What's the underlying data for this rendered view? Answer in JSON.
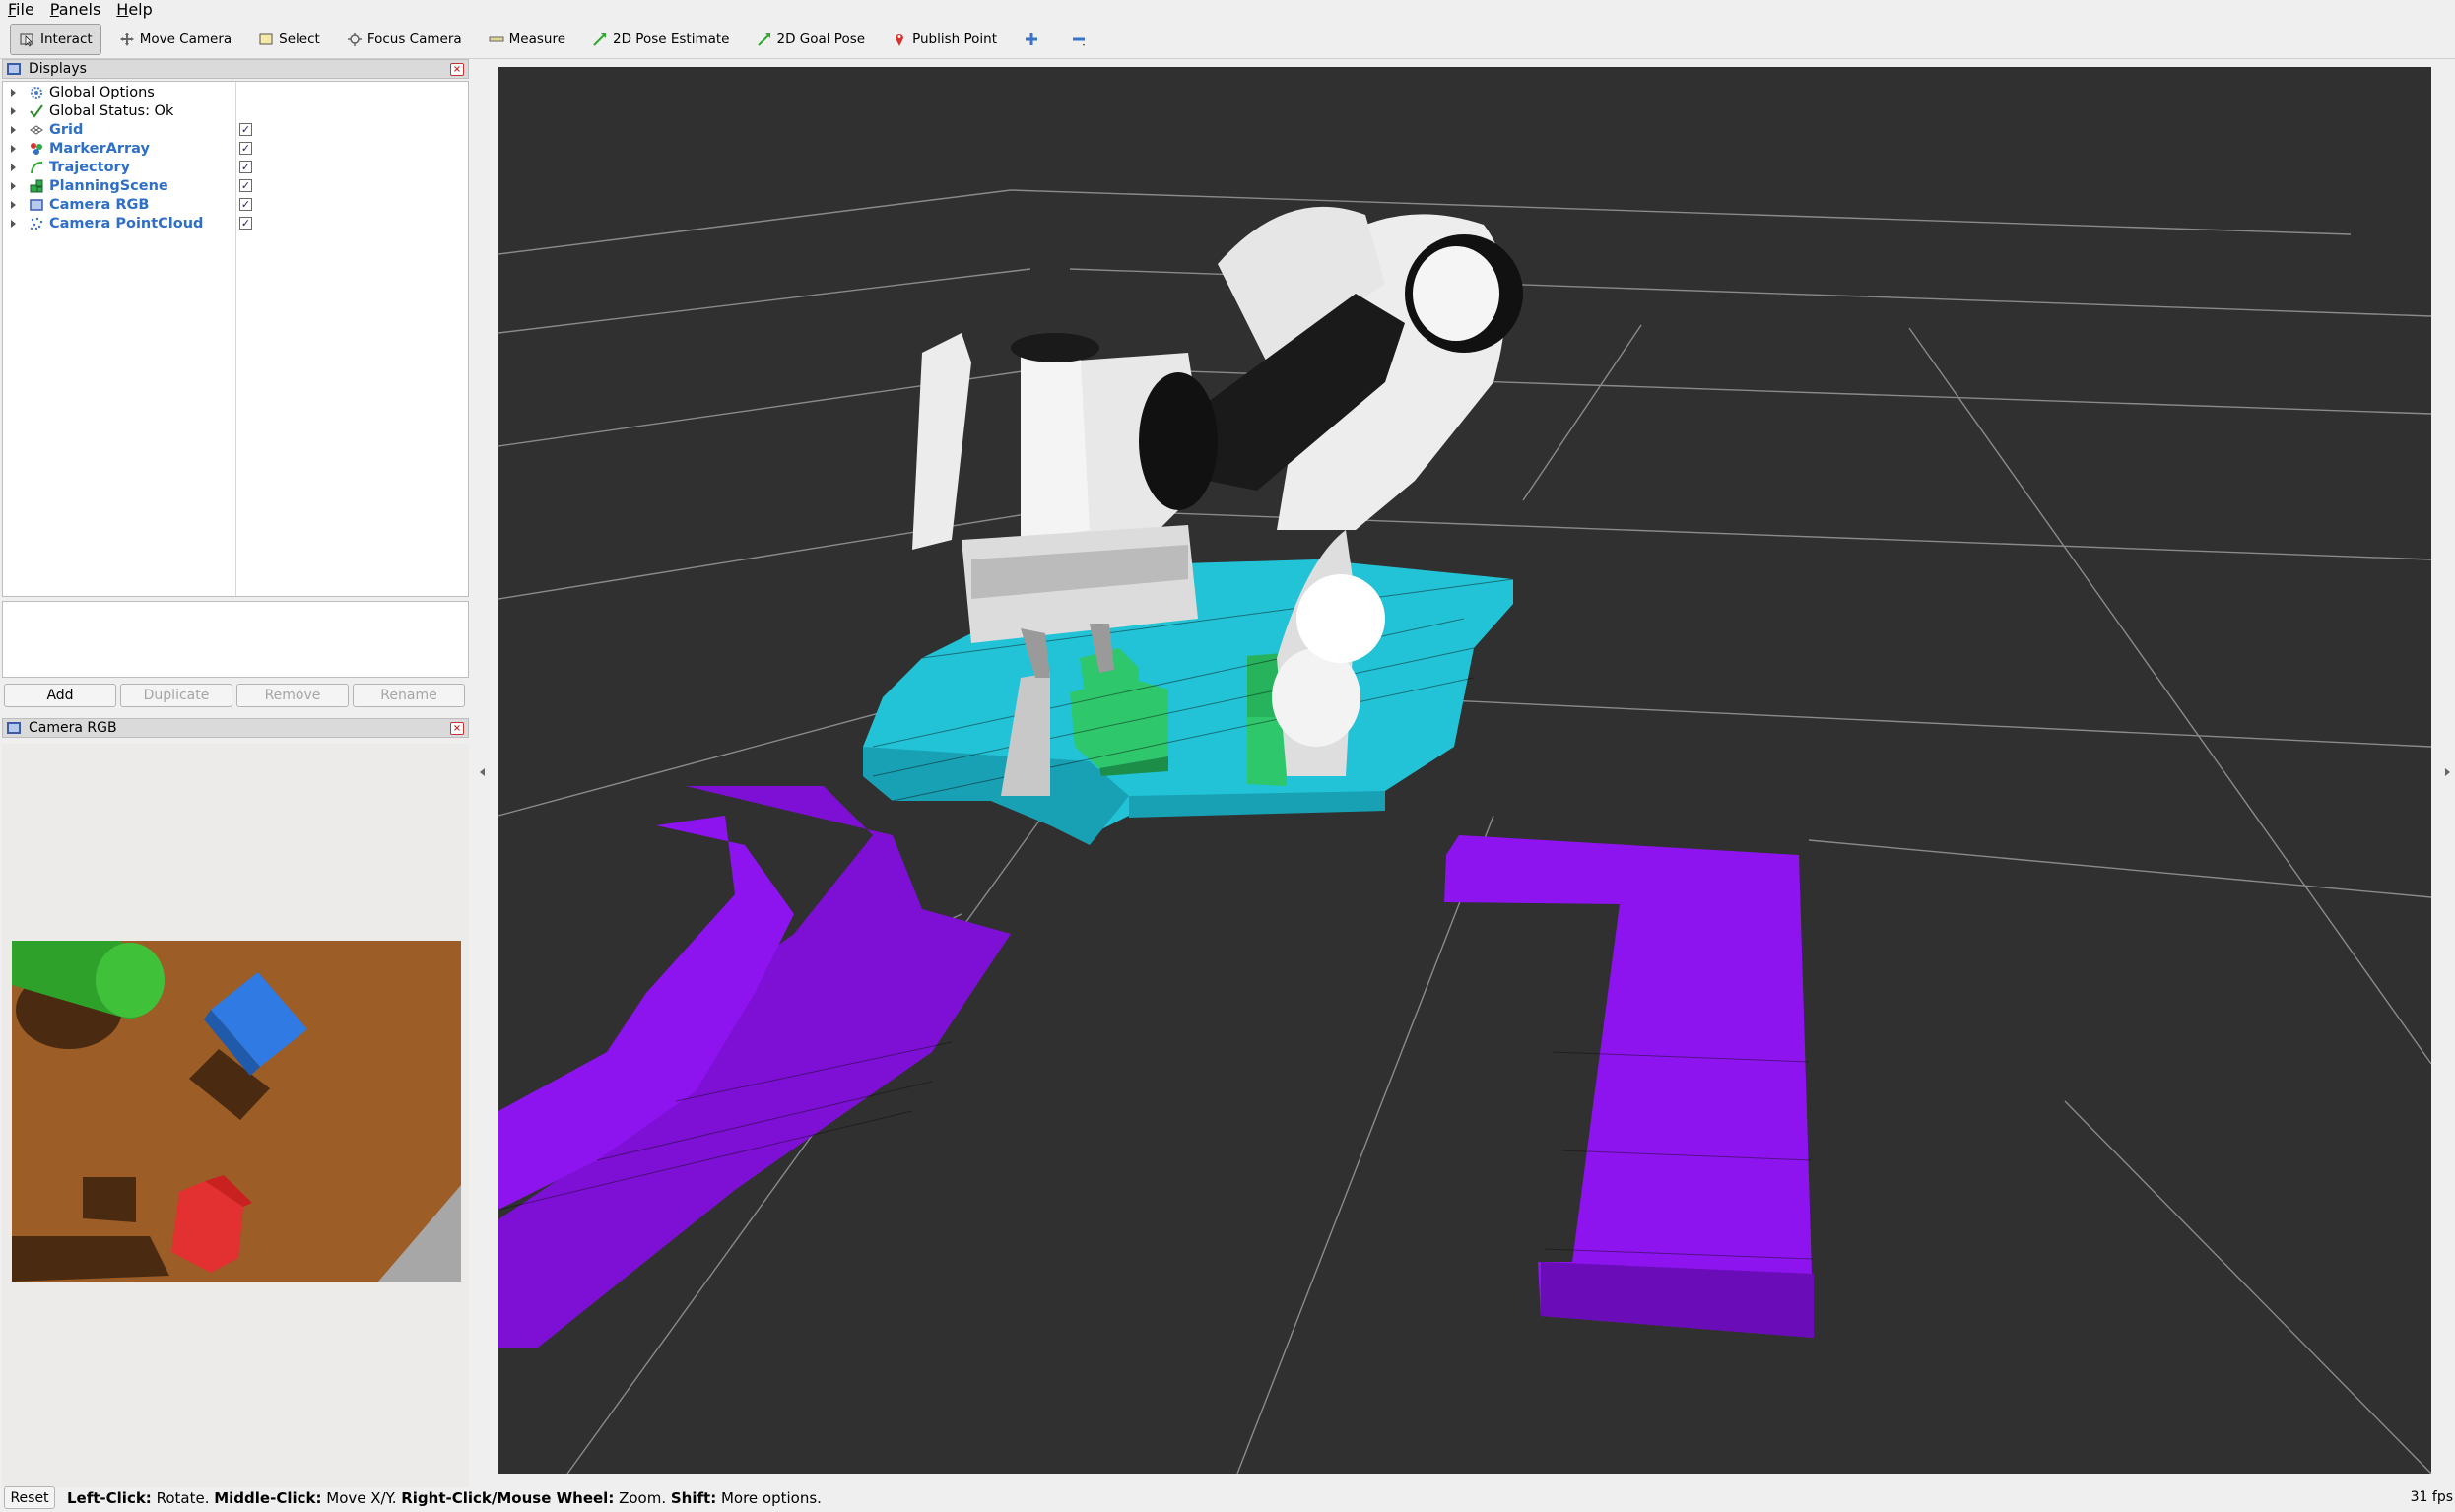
{
  "menu": [
    "File",
    "Panels",
    "Help"
  ],
  "toolbar": {
    "tools": [
      {
        "label": "Interact",
        "icon": "cursor-icon",
        "active": true
      },
      {
        "label": "Move Camera",
        "icon": "move-camera-icon",
        "active": false
      },
      {
        "label": "Select",
        "icon": "select-icon",
        "active": false
      },
      {
        "label": "Focus Camera",
        "icon": "focus-camera-icon",
        "active": false
      },
      {
        "label": "Measure",
        "icon": "ruler-icon",
        "active": false
      },
      {
        "label": "2D Pose Estimate",
        "icon": "pose-estimate-icon",
        "active": false
      },
      {
        "label": "2D Goal Pose",
        "icon": "goal-pose-icon",
        "active": false
      },
      {
        "label": "Publish Point",
        "icon": "pin-icon",
        "active": false
      }
    ]
  },
  "displays_panel": {
    "title": "Displays",
    "items": [
      {
        "label": "Global Options",
        "icon": "gear-icon",
        "bold": false,
        "checked": null
      },
      {
        "label": "Global Status: Ok",
        "icon": "checkmark-icon",
        "bold": false,
        "checked": null
      },
      {
        "label": "Grid",
        "icon": "grid-icon",
        "bold": true,
        "checked": true
      },
      {
        "label": "MarkerArray",
        "icon": "marker-array-icon",
        "bold": true,
        "checked": true
      },
      {
        "label": "Trajectory",
        "icon": "trajectory-icon",
        "bold": true,
        "checked": true
      },
      {
        "label": "PlanningScene",
        "icon": "planning-scene-icon",
        "bold": true,
        "checked": true
      },
      {
        "label": "Camera RGB",
        "icon": "camera-icon",
        "bold": true,
        "checked": true
      },
      {
        "label": "Camera PointCloud",
        "icon": "pointcloud-icon",
        "bold": true,
        "checked": true
      }
    ],
    "buttons": {
      "add": "Add",
      "duplicate": "Duplicate",
      "remove": "Remove",
      "rename": "Rename"
    }
  },
  "camera_panel": {
    "title": "Camera RGB"
  },
  "statusbar": {
    "reset": "Reset",
    "hint_parts": [
      {
        "text": "Left-Click:",
        "bold": true
      },
      {
        "text": " Rotate. ",
        "bold": false
      },
      {
        "text": "Middle-Click:",
        "bold": true
      },
      {
        "text": " Move X/Y. ",
        "bold": false
      },
      {
        "text": "Right-Click/Mouse Wheel:",
        "bold": true
      },
      {
        "text": " Zoom. ",
        "bold": false
      },
      {
        "text": "Shift:",
        "bold": true
      },
      {
        "text": " More options.",
        "bold": false
      }
    ],
    "fps": "31 fps"
  },
  "colors": {
    "viewport_bg": "#303030",
    "grid_line": "#8a8a8a",
    "voxel_cyan": "#1ec8dc",
    "voxel_purple": "#8a10e6",
    "voxel_green": "#23c46a",
    "link_blue": "#2f6fc6"
  }
}
